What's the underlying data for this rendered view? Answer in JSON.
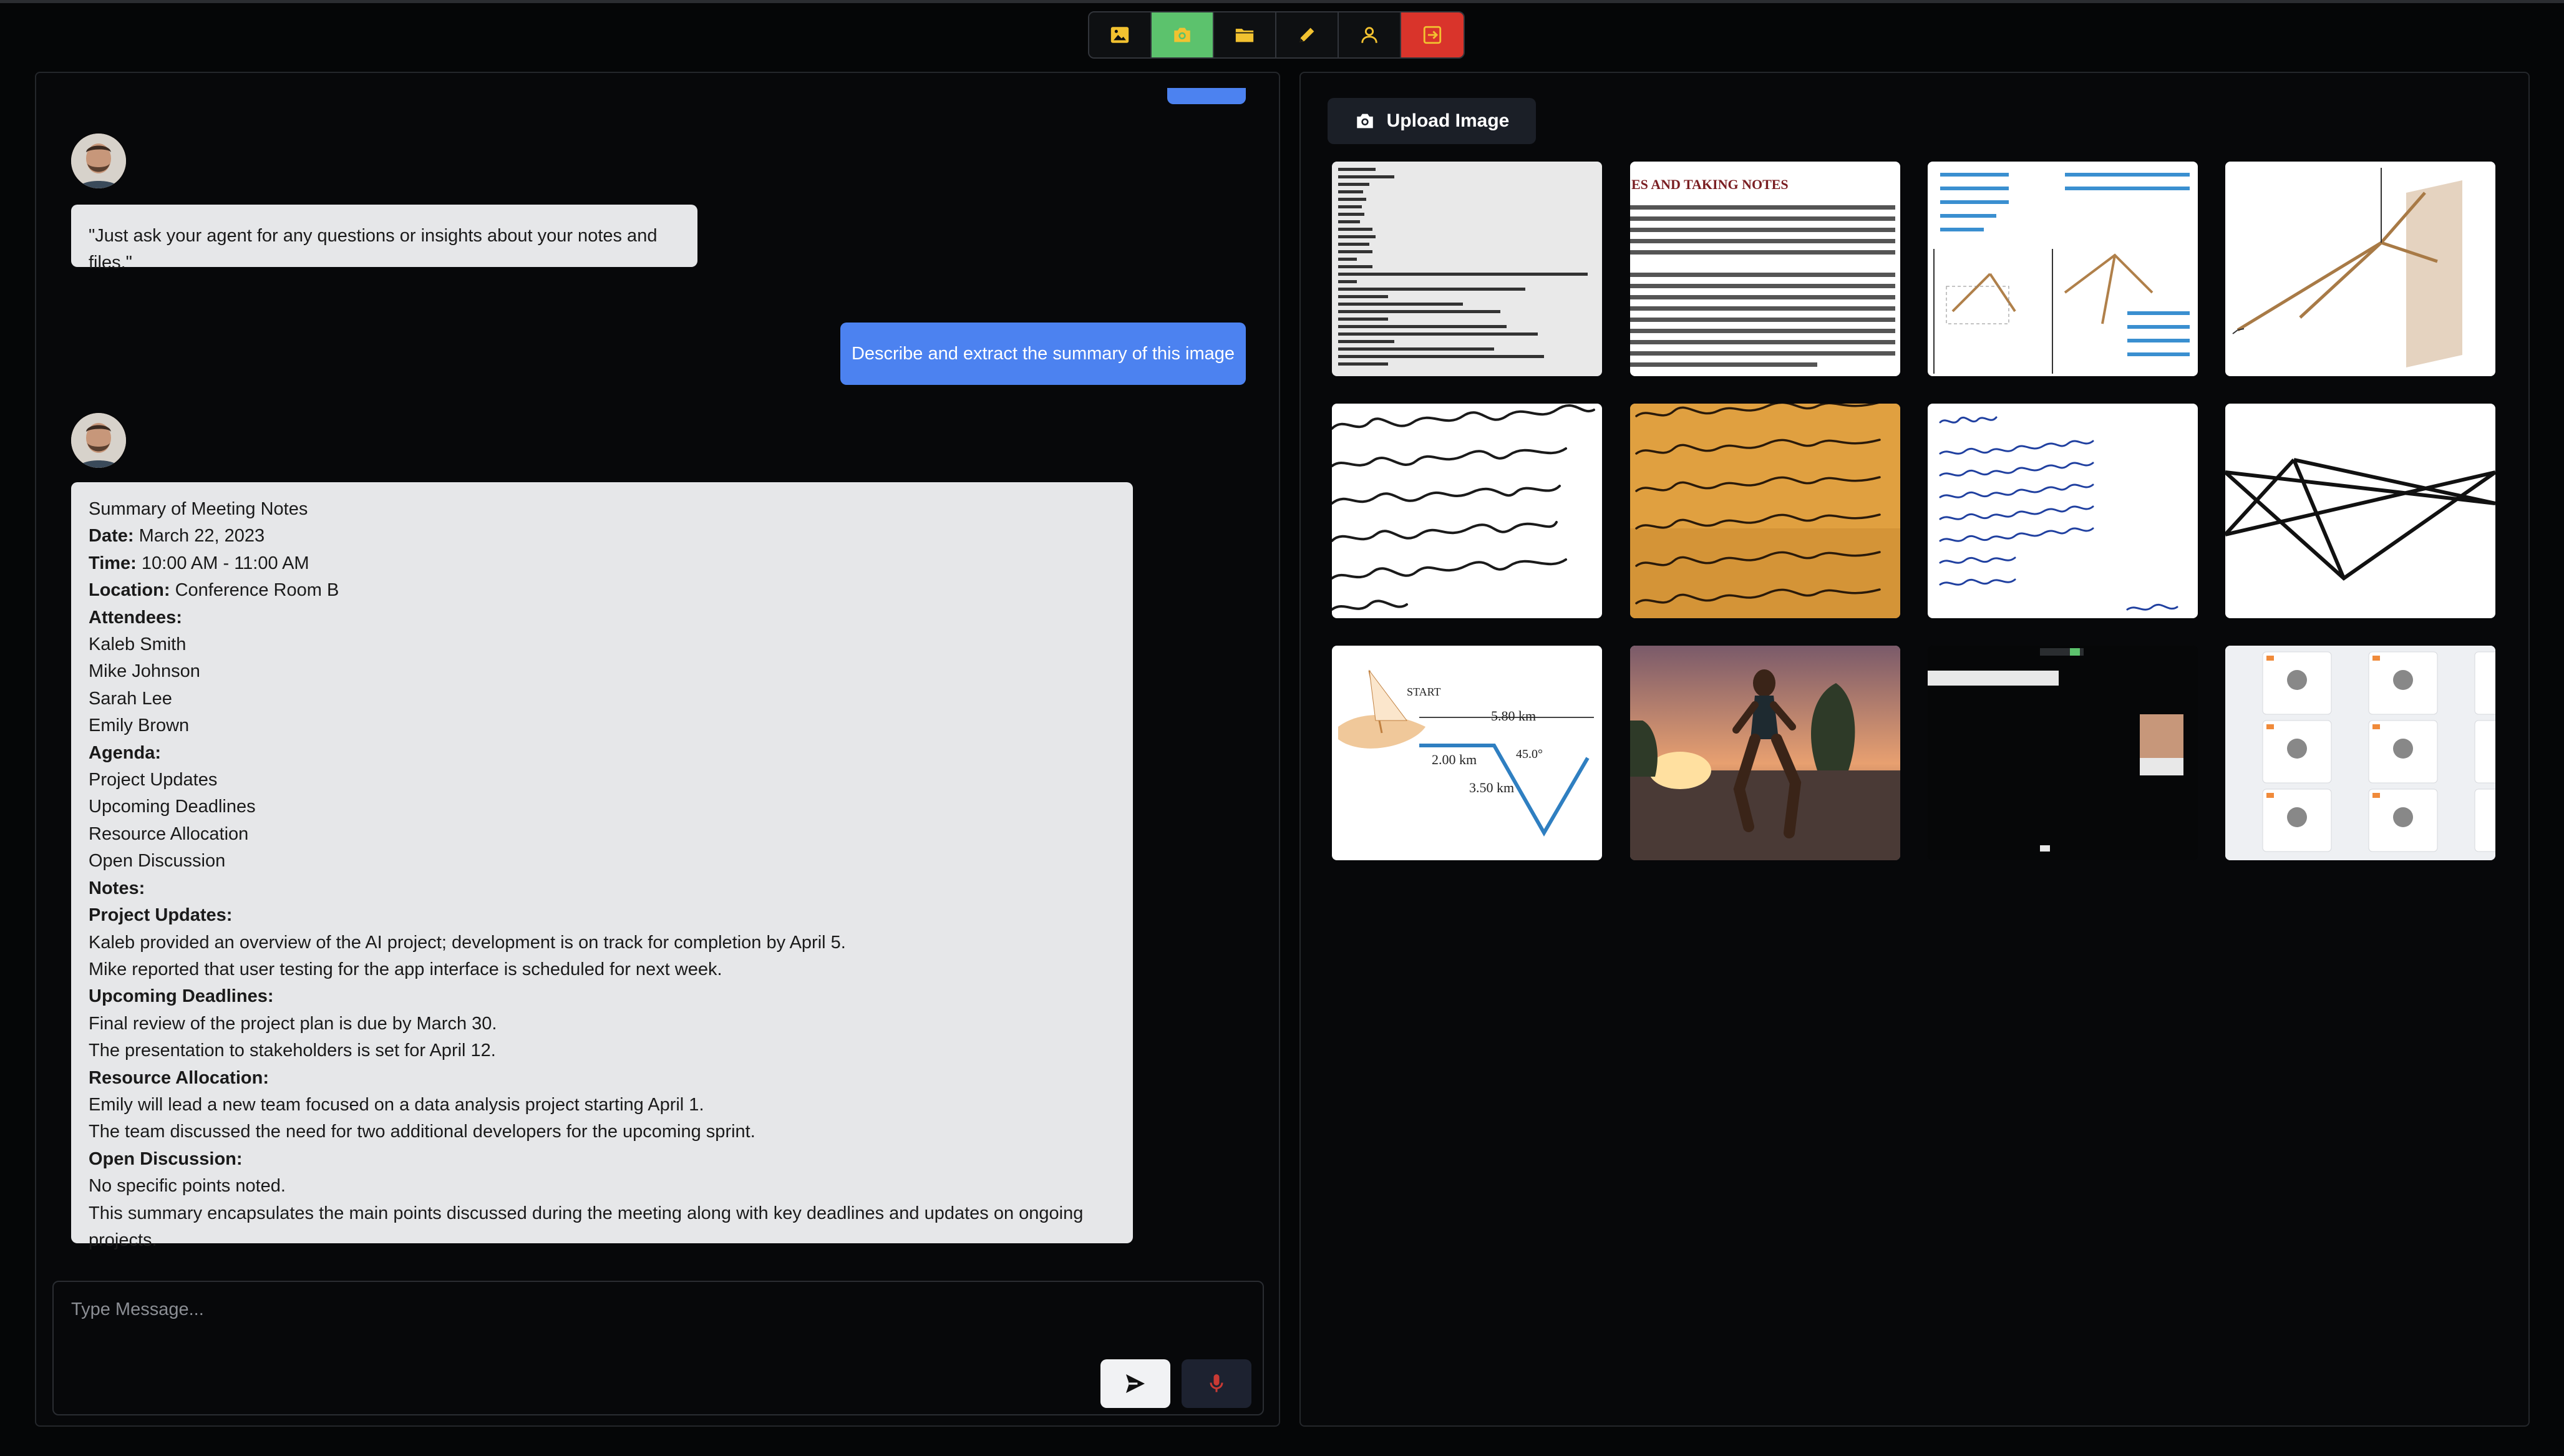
{
  "toolbar": {
    "buttons": [
      {
        "name": "image-icon",
        "color": "#f2c230"
      },
      {
        "name": "camera-icon",
        "color": "#f2c230",
        "active": true
      },
      {
        "name": "folder-icon",
        "color": "#f2c230"
      },
      {
        "name": "pencil-icon",
        "color": "#f2c230"
      },
      {
        "name": "user-icon",
        "color": "#f2c230"
      },
      {
        "name": "logout-icon",
        "color": "#f2c230",
        "danger": true
      }
    ]
  },
  "chat": {
    "messages": [
      {
        "role": "agent",
        "text": "\"Just ask your agent for any questions or insights about your notes and files.\""
      },
      {
        "role": "user",
        "text": "Describe and extract the summary of this image"
      }
    ],
    "summary": {
      "title": "Summary of Meeting Notes",
      "date_label": "Date:",
      "date": "March 22, 2023",
      "time_label": "Time:",
      "time": "10:00 AM - 11:00 AM",
      "location_label": "Location:",
      "location": "Conference Room B",
      "attendees_label": "Attendees:",
      "attendees": [
        "Kaleb Smith",
        "Mike Johnson",
        "Sarah Lee",
        "Emily Brown"
      ],
      "agenda_label": "Agenda:",
      "agenda": [
        "Project Updates",
        "Upcoming Deadlines",
        "Resource Allocation",
        "Open Discussion"
      ],
      "notes_label": "Notes:",
      "project_updates_label": "Project Updates:",
      "project_updates": [
        "Kaleb provided an overview of the AI project; development is on track for completion by April 5.",
        "Mike reported that user testing for the app interface is scheduled for next week."
      ],
      "deadlines_label": "Upcoming Deadlines:",
      "deadlines": [
        "Final review of the project plan is due by March 30.",
        "The presentation to stakeholders is set for April 12."
      ],
      "resources_label": "Resource Allocation:",
      "resources": [
        "Emily will lead a new team focused on a data analysis project starting April 1.",
        "The team discussed the need for two additional developers for the upcoming sprint."
      ],
      "open_label": "Open Discussion:",
      "open": [
        "No specific points noted."
      ],
      "closing": "This summary encapsulates the main points discussed during the meeting along with key deadlines and updates on ongoing projects."
    },
    "input_placeholder": "Type Message..."
  },
  "gallery": {
    "upload_label": "Upload Image",
    "thumbnails": [
      {
        "name": "meeting-notes-thumbnail"
      },
      {
        "name": "taking-notes-page-thumbnail",
        "heading": "ES AND TAKING NOTES"
      },
      {
        "name": "physics-angle-diagram-thumbnail"
      },
      {
        "name": "vector-wall-diagram-thumbnail"
      },
      {
        "name": "handwriting-sample-thumbnail"
      },
      {
        "name": "handwritten-letter-thumbnail"
      },
      {
        "name": "dear-user-note-thumbnail"
      },
      {
        "name": "geometry-lines-thumbnail"
      },
      {
        "name": "displacement-diagram-thumbnail",
        "labels": [
          "START",
          "5.80 km",
          "2.00 km",
          "45.0°",
          "3.50 km"
        ]
      },
      {
        "name": "runner-photo-thumbnail"
      },
      {
        "name": "video-call-screenshot-thumbnail"
      },
      {
        "name": "dashboard-cards-thumbnail"
      }
    ]
  }
}
